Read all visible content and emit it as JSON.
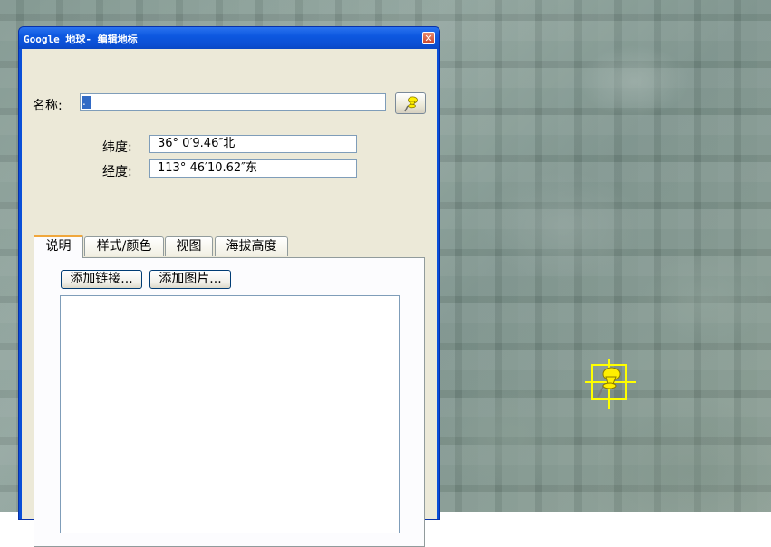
{
  "window": {
    "title": "Google 地球- 编辑地标"
  },
  "form": {
    "name_label": "名称:",
    "name_value": ".",
    "latitude_label": "纬度:",
    "latitude_value": "36° 0′9.46″北",
    "longitude_label": "经度:",
    "longitude_value": "113° 46′10.62″东"
  },
  "tabs": [
    {
      "label": "说明",
      "active": true
    },
    {
      "label": "样式/颜色",
      "active": false
    },
    {
      "label": "视图",
      "active": false
    },
    {
      "label": "海拔高度",
      "active": false
    }
  ],
  "description": {
    "add_link_label": "添加链接...",
    "add_image_label": "添加图片..."
  },
  "icons": {
    "close": "close-icon",
    "pushpin": "pushpin-icon",
    "placemark": "placemark-pushpin-icon"
  },
  "colors": {
    "titlebar": "#0b4fd4",
    "dialog_face": "#ece9d8",
    "pushpin": "#ffef00",
    "selection_highlight": "#ffff00"
  }
}
